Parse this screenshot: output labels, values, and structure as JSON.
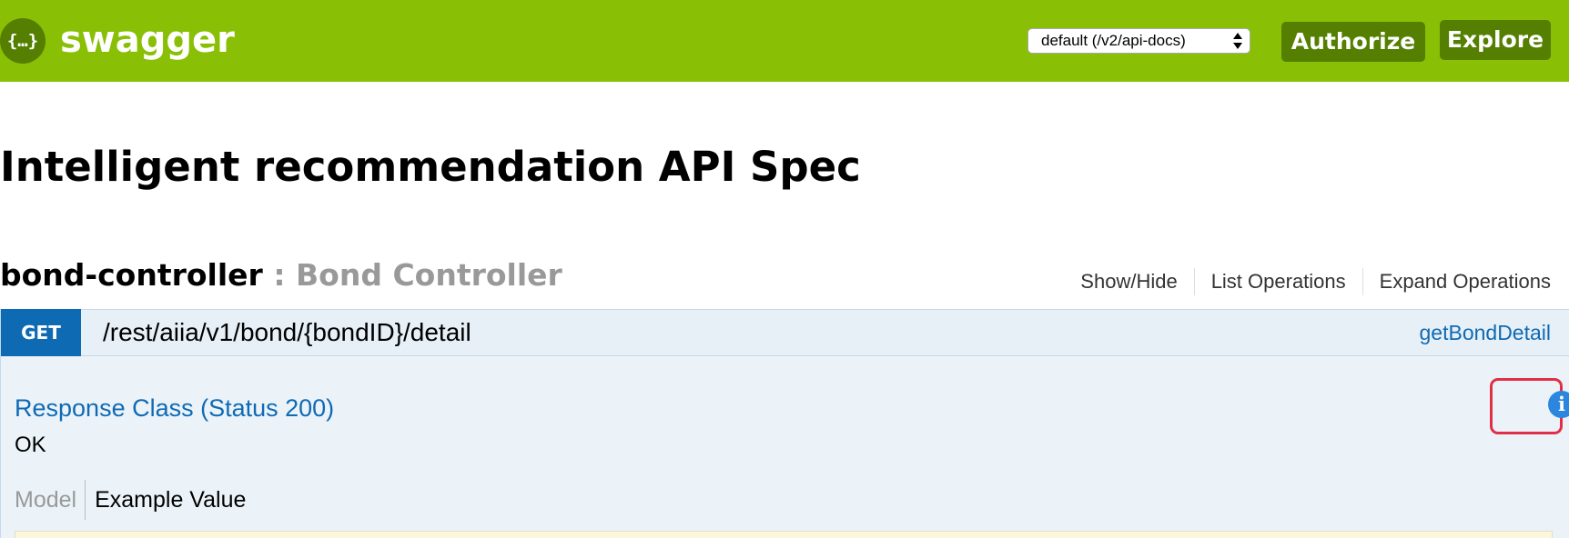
{
  "header": {
    "logo_glyph": "{…}",
    "logo_text": "swagger",
    "spec_selector": "default (/v2/api-docs)",
    "authorize_label": "Authorize",
    "explore_label": "Explore",
    "background_color": "#89bf04",
    "button_color": "#547f00"
  },
  "api": {
    "title": "Intelligent recommendation API Spec"
  },
  "controller": {
    "name": "bond-controller",
    "description": " : Bond Controller",
    "links": [
      "Show/Hide",
      "List Operations",
      "Expand Operations"
    ]
  },
  "operation": {
    "method": "GET",
    "method_color": "#0f6ab4",
    "path": "/rest/aiia/v1/bond/{bondID}/detail",
    "nickname": "getBondDetail",
    "response_class_title": "Response Class (Status 200)",
    "response_status": "OK",
    "tabs": [
      "Model",
      "Example Value"
    ],
    "info_icon": "info-icon",
    "highlight_color": "#e03047"
  }
}
